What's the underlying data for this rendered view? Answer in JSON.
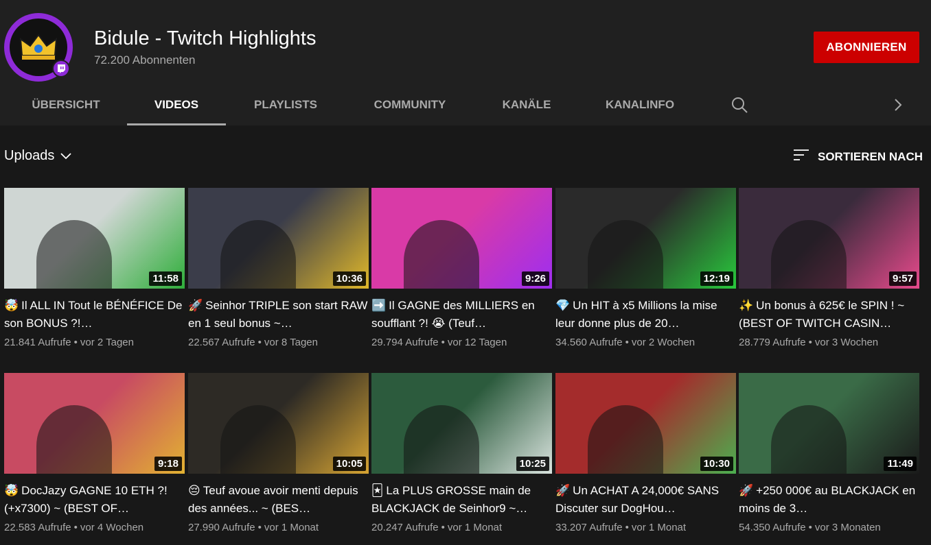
{
  "channel": {
    "name": "Bidule - Twitch Highlights",
    "subscribers": "72.200 Abonnenten",
    "subscribe_label": "ABONNIEREN",
    "accent": "#8e2bd8",
    "subscribe_color": "#cc0000"
  },
  "tabs": [
    {
      "label": "ÜBERSICHT"
    },
    {
      "label": "VIDEOS",
      "active": true
    },
    {
      "label": "PLAYLISTS"
    },
    {
      "label": "COMMUNITY"
    },
    {
      "label": "KANÄLE"
    },
    {
      "label": "KANALINFO"
    }
  ],
  "icons": {
    "search": "search-icon",
    "next": "chevron-right-icon",
    "dropdown": "chevron-down-icon",
    "sort": "sort-icon"
  },
  "filter": {
    "uploads_label": "Uploads",
    "sort_label": "SORTIEREN NACH"
  },
  "videos": [
    {
      "emoji": "🤯",
      "title": "Il ALL IN Tout le BÉNÉFICE De son BONUS ?!…",
      "views": "21.841 Aufrufe",
      "age": "vor 2 Tagen",
      "duration": "11:58",
      "colors": [
        "#cfd6d3",
        "#2fae3a"
      ]
    },
    {
      "emoji": "🚀",
      "title": "Seinhor TRIPLE son start RAW en 1 seul bonus ~…",
      "views": "22.567 Aufrufe",
      "age": "vor 8 Tagen",
      "duration": "10:36",
      "colors": [
        "#3b3d4a",
        "#e0b82a"
      ]
    },
    {
      "emoji": "➡️",
      "title": "Il GAGNE des MILLIERS en soufflant ?! 😭 (Teuf…",
      "views": "29.794 Aufrufe",
      "age": "vor 12 Tagen",
      "duration": "9:26",
      "colors": [
        "#d93aa7",
        "#9e2ef0"
      ]
    },
    {
      "emoji": "💎",
      "title": "Un HIT à x5 Millions la mise leur donne plus de 20…",
      "views": "34.560 Aufrufe",
      "age": "vor 2 Wochen",
      "duration": "12:19",
      "colors": [
        "#2a2a2a",
        "#29c93c"
      ]
    },
    {
      "emoji": "✨",
      "title": "Un bonus à 625€ le SPIN ! ~ (BEST OF TWITCH CASIN…",
      "views": "28.779 Aufrufe",
      "age": "vor 3 Wochen",
      "duration": "9:57",
      "colors": [
        "#3a2b3c",
        "#e74a8c"
      ]
    },
    {
      "emoji": "🤯",
      "title": "DocJazy GAGNE 10 ETH ?! (+x7300) ~ (BEST OF…",
      "views": "22.583 Aufrufe",
      "age": "vor 4 Wochen",
      "duration": "9:18",
      "colors": [
        "#c84b62",
        "#e2b232"
      ]
    },
    {
      "emoji": "😔",
      "title": "Teuf avoue avoir menti depuis des années... ~ (BES…",
      "views": "27.990 Aufrufe",
      "age": "vor 1 Monat",
      "duration": "10:05",
      "colors": [
        "#2d2a25",
        "#d6a433"
      ]
    },
    {
      "emoji": "🃏",
      "title": "La PLUS GROSSE main de BLACKJACK de Seinhor9 ~…",
      "views": "20.247 Aufrufe",
      "age": "vor 1 Monat",
      "duration": "10:25",
      "colors": [
        "#2c5b3d",
        "#d9e3de"
      ]
    },
    {
      "emoji": "🚀",
      "title": "Un ACHAT A 24,000€ SANS Discuter sur DogHou…",
      "views": "33.207 Aufrufe",
      "age": "vor 1 Monat",
      "duration": "10:30",
      "colors": [
        "#a42c2c",
        "#4caf50"
      ]
    },
    {
      "emoji": "🚀",
      "title": "+250 000€ au BLACKJACK en moins de 3…",
      "views": "54.350 Aufrufe",
      "age": "vor 3 Monaten",
      "duration": "11:49",
      "colors": [
        "#3a6b47",
        "#1a1a1a"
      ]
    }
  ]
}
